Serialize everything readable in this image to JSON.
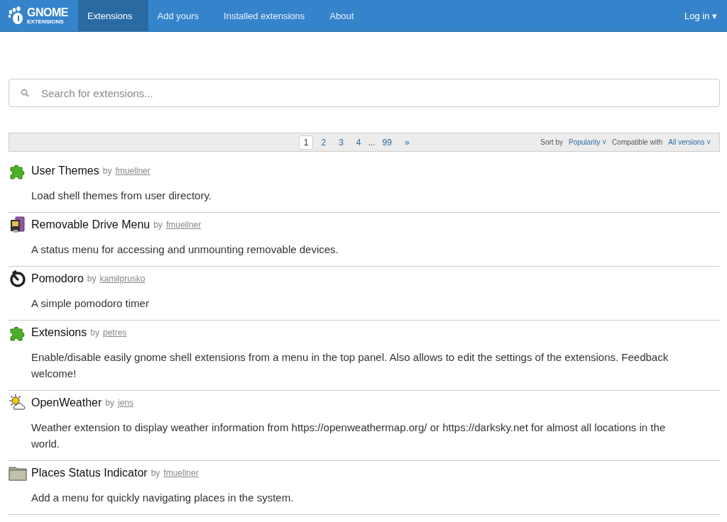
{
  "navbar": {
    "logo": {
      "title": "GNOME",
      "subtitle": "EXTENSIONS"
    },
    "tabs": [
      {
        "label": "Extensions",
        "selected": true
      },
      {
        "label": "Add yours",
        "selected": false
      },
      {
        "label": "Installed extensions",
        "selected": false
      },
      {
        "label": "About",
        "selected": false
      }
    ],
    "login": {
      "label": "Log in",
      "caret": "▾"
    }
  },
  "search": {
    "placeholder": "Search for extensions..."
  },
  "pager": {
    "pages": [
      {
        "label": "1",
        "selected": true
      },
      {
        "label": "2",
        "selected": false
      },
      {
        "label": "3",
        "selected": false
      },
      {
        "label": "4",
        "selected": false
      }
    ],
    "ellipsis": "...",
    "last": "99",
    "next": "»",
    "sort_label": "Sort by",
    "sort_value": "Popularity",
    "compat_label": "Compatible with",
    "compat_value": "All versions",
    "caret": "˅"
  },
  "extensions": [
    {
      "kind": "puzzle",
      "name": "User Themes",
      "by": "by",
      "author": "fmuellner",
      "description": "Load shell themes from user directory."
    },
    {
      "kind": "drive",
      "name": "Removable Drive Menu",
      "by": "by",
      "author": "fmuellner",
      "description": "A status menu for accessing and unmounting removable devices."
    },
    {
      "kind": "timer",
      "name": "Pomodoro",
      "by": "by",
      "author": "kamilprusko",
      "description": "A simple pomodoro timer"
    },
    {
      "kind": "puzzle",
      "name": "Extensions",
      "by": "by",
      "author": "petres",
      "description": "Enable/disable easily gnome shell extensions from a menu in the top panel. Also allows to edit the settings of the extensions. Feedback welcome!"
    },
    {
      "kind": "weather",
      "name": "OpenWeather",
      "by": "by",
      "author": "jens",
      "description": "Weather extension to display weather information from https://openweathermap.org/ or https://darksky.net for almost all locations in the world."
    },
    {
      "kind": "folder",
      "name": "Places Status Indicator",
      "by": "by",
      "author": "fmuellner",
      "description": "Add a menu for quickly navigating places in the system."
    }
  ]
}
